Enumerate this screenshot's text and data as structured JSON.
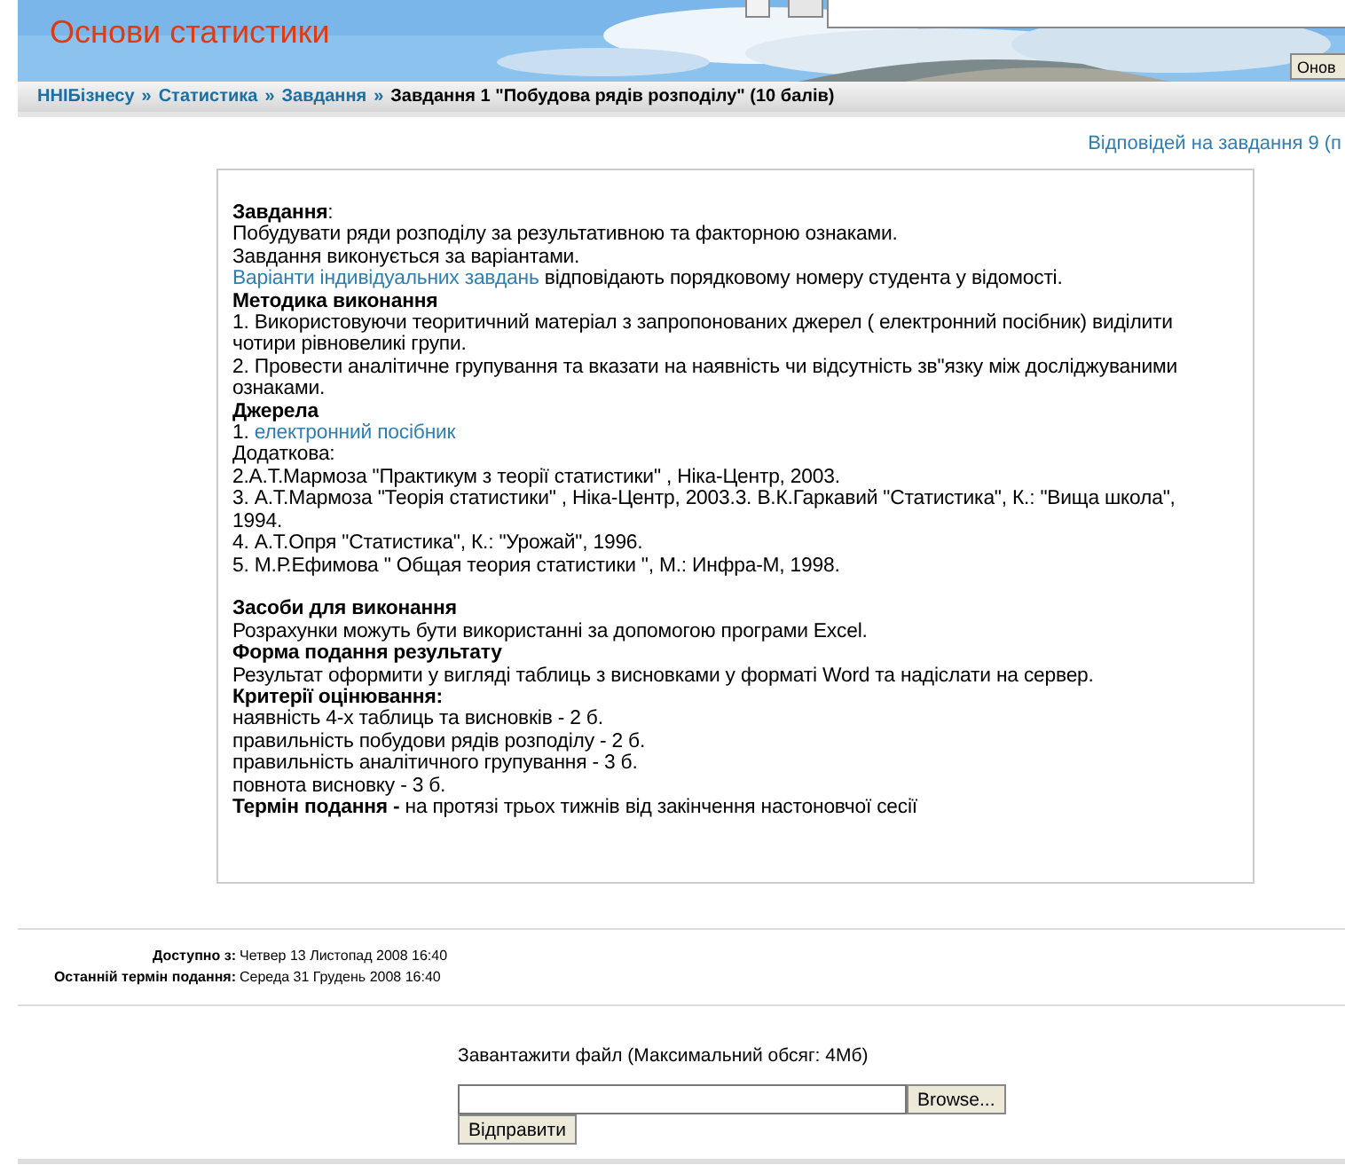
{
  "header": {
    "title": "Основи статистики",
    "refresh_button": "Онов"
  },
  "breadcrumb": {
    "links": [
      "ННІБізнесу",
      "Статистика",
      "Завдання"
    ],
    "separator": "»",
    "current": "Завдання 1 \"Побудова рядів розподілу\" (10 балів)"
  },
  "responses_link": "Відповідей на завдання 9 (п",
  "body": [
    {
      "kind": "text",
      "text": "**Завдання**:"
    },
    {
      "kind": "text",
      "text": "Побудувати ряди розподілу за результативною та факторною ознаками."
    },
    {
      "kind": "text",
      "text": "Завдання виконується за варіантами."
    },
    {
      "kind": "link",
      "link": "Варіанти індивідуальних завдань",
      "text": " відповідають порядковому номеру студента у відомості."
    },
    {
      "kind": "heading",
      "text": "Методика виконання"
    },
    {
      "kind": "text",
      "text": "1. Використовуючи теоритичний матеріал з запропонованих джерел ( електронний посібник) виділити чотири рівновеликі групи."
    },
    {
      "kind": "text",
      "text": "2. Провести аналітичне групування та вказати на наявність чи відсутність зв\"язку між досліджуваними ознаками."
    },
    {
      "kind": "heading",
      "text": "Джерела"
    },
    {
      "kind": "link",
      "prefix": "1. ",
      "link": "електронний посібник"
    },
    {
      "kind": "text",
      "text": "Додаткова:"
    },
    {
      "kind": "text",
      "text": "2.А.Т.Мармоза \"Практикум з теорії статистики\" , Ніка-Центр, 2003."
    },
    {
      "kind": "text",
      "text": "3. А.Т.Мармоза \"Теорія статистики\" , Ніка-Центр, 2003.3. В.К.Гаркавий \"Статистика\", К.: \"Вища школа\", 1994."
    },
    {
      "kind": "text",
      "text": "4. А.Т.Опря \"Статистика\", К.: \"Урожай\", 1996."
    },
    {
      "kind": "text",
      "text": "5. М.Р.Ефимова \" Общая теория статистики \", М.: Инфра-М, 1998."
    },
    {
      "kind": "spacer"
    },
    {
      "kind": "heading",
      "text": "Засоби для виконання"
    },
    {
      "kind": "text",
      "text": "Розрахунки можуть бути використанні за допомогою програми Excel."
    },
    {
      "kind": "heading",
      "text": "Форма подання результату"
    },
    {
      "kind": "text",
      "text": "Результат оформити у вигляді таблиць з висновками у форматі Word та надіслати на сервер."
    },
    {
      "kind": "heading",
      "text": "Критерії оцінювання:"
    },
    {
      "kind": "text",
      "text": "наявність 4-х таблиць та висновків - 2 б."
    },
    {
      "kind": "text",
      "text": "правильність побудови рядів розподілу - 2 б."
    },
    {
      "kind": "text",
      "text": "правильність аналітичного групування - 3 б."
    },
    {
      "kind": "text",
      "text": "повнота висновку - 3 б."
    },
    {
      "kind": "text",
      "text": "**Термін подання -** на протязі трьох тижнів від закінчення настоновчої сесії"
    }
  ],
  "dates": [
    {
      "label": "Доступно з:",
      "value": "Четвер 13 Листопад 2008 16:40"
    },
    {
      "label": "Останній термін подання:",
      "value": "Середа 31 Грудень 2008 16:40"
    }
  ],
  "upload": {
    "label": "Завантажити файл (Максимальний обсяг: 4Мб)",
    "browse_button": "Browse...",
    "submit_button": "Відправити"
  }
}
